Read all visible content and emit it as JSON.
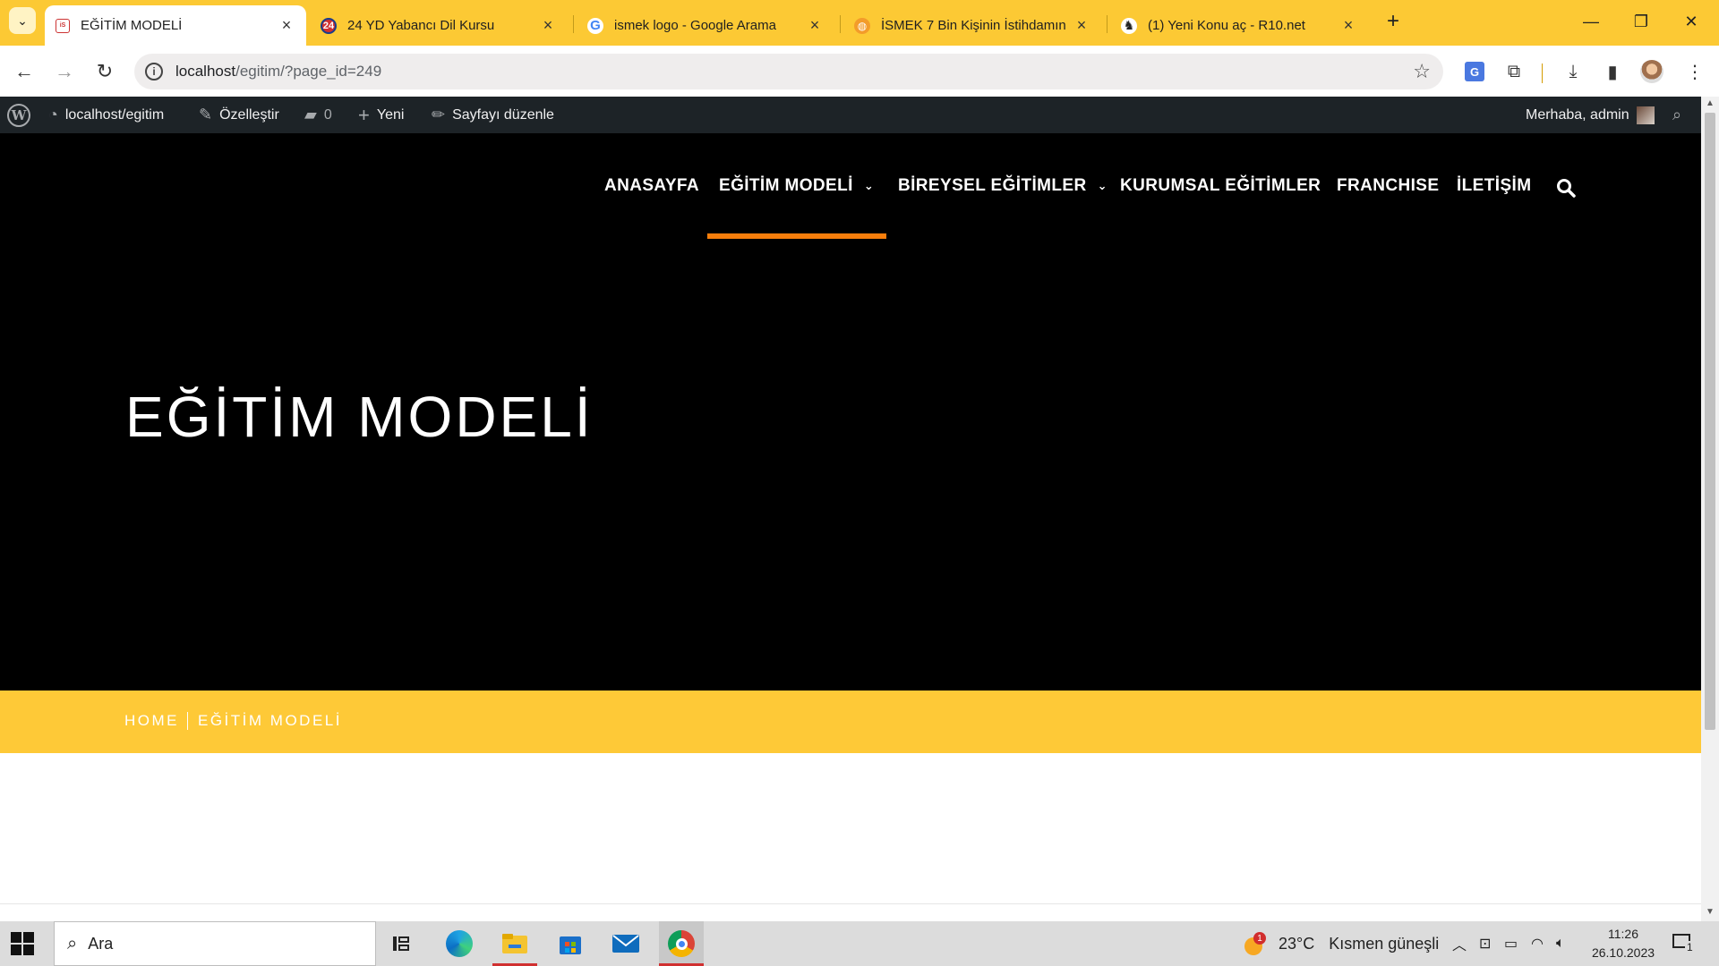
{
  "browser": {
    "tabs": [
      {
        "title": "EĞİTİM MODELİ",
        "active": true
      },
      {
        "title": "24 YD Yabancı Dil Kursu",
        "active": false
      },
      {
        "title": "ismek logo - Google Arama",
        "active": false
      },
      {
        "title": "İSMEK 7 Bin Kişinin İstihdamın",
        "active": false
      },
      {
        "title": "(1) Yeni Konu aç - R10.net",
        "active": false
      }
    ],
    "url_host": "localhost",
    "url_path": "/egitim/?page_id=249"
  },
  "adminbar": {
    "site": "localhost/egitim",
    "customize": "Özelleştir",
    "comments": "0",
    "new": "Yeni",
    "edit": "Sayfayı düzenle",
    "greeting": "Merhaba, admin"
  },
  "nav": {
    "items": [
      {
        "label": "ANASAYFA"
      },
      {
        "label": "EĞİTİM MODELİ"
      },
      {
        "label": "BİREYSEL EĞİTİMLER"
      },
      {
        "label": "KURUMSAL EĞİTİMLER"
      },
      {
        "label": "FRANCHISE"
      },
      {
        "label": "İLETİŞİM"
      }
    ]
  },
  "hero": {
    "title": "EĞİTİM MODELİ"
  },
  "breadcrumb": {
    "home": "HOME",
    "current": "EĞİTİM MODELİ"
  },
  "taskbar": {
    "search_placeholder": "Ara",
    "weather_temp": "23°C",
    "weather_desc": "Kısmen güneşli",
    "weather_badge": "1",
    "time": "11:26",
    "date": "26.10.2023",
    "notifications": "1"
  },
  "colors": {
    "tabstrip": "#fcc934",
    "accent_orange": "#f77e0b",
    "breadcrumb_band": "#fec937",
    "adminbar": "#1d2327"
  }
}
